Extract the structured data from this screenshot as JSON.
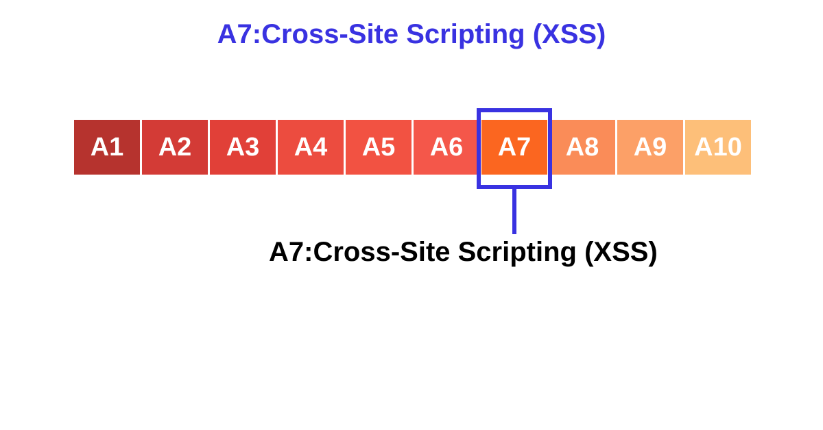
{
  "title": "A7:Cross-Site Scripting (XSS)",
  "cells": [
    {
      "label": "A1",
      "color": "#B6332E"
    },
    {
      "label": "A2",
      "color": "#D33B36"
    },
    {
      "label": "A3",
      "color": "#E14038"
    },
    {
      "label": "A4",
      "color": "#EC4C3F"
    },
    {
      "label": "A5",
      "color": "#F25242"
    },
    {
      "label": "A6",
      "color": "#F4574A"
    },
    {
      "label": "A7",
      "color": "#FB6620"
    },
    {
      "label": "A8",
      "color": "#FA8C58"
    },
    {
      "label": "A9",
      "color": "#FCA067"
    },
    {
      "label": "A10",
      "color": "#FDBF79"
    }
  ],
  "highlight_index": 6,
  "callout_label": "A7:Cross-Site Scripting (XSS)",
  "colors": {
    "accent": "#3932E1"
  }
}
